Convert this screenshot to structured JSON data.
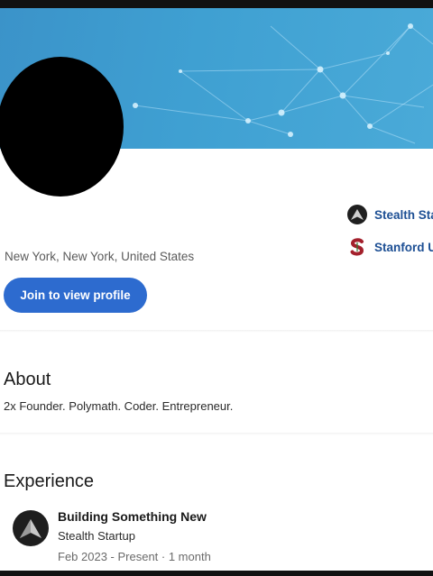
{
  "profile": {
    "location": "New York, New York, United States",
    "join_button": "Join to view profile"
  },
  "sidebar": {
    "items": [
      {
        "label": "Stealth Sta",
        "icon": "stealth-logo-icon"
      },
      {
        "label": "Stanford U",
        "icon": "stanford-logo-icon"
      }
    ]
  },
  "about": {
    "heading": "About",
    "text": "2x Founder. Polymath. Coder. Entrepreneur."
  },
  "experience": {
    "heading": "Experience",
    "items": [
      {
        "title": "Building Something New",
        "company": "Stealth Startup",
        "dates": "Feb 2023 - Present · 1 month",
        "icon": "stealth-logo-icon"
      }
    ]
  },
  "colors": {
    "banner": "#3fa0d2",
    "button": "#2d6bcf",
    "link": "#1d4f94",
    "stanford": "#a3202c"
  }
}
